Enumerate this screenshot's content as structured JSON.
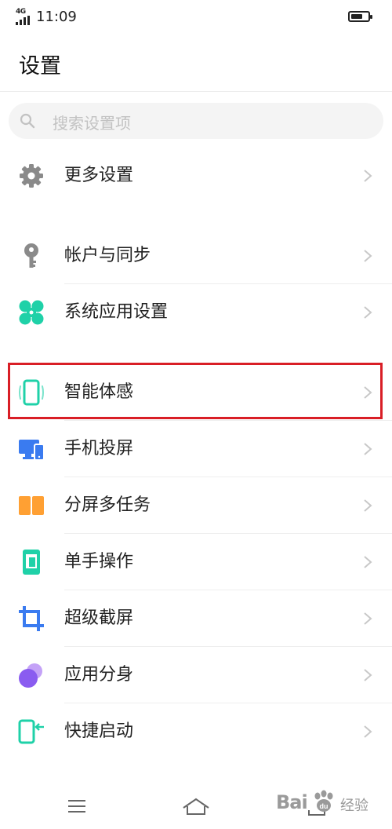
{
  "status_bar": {
    "network": "4G",
    "time": "11:09"
  },
  "header": {
    "title": "设置"
  },
  "search": {
    "placeholder": "搜索设置项"
  },
  "items": [
    {
      "label": "更多设置",
      "icon": "gear-icon"
    },
    {
      "label": "帐户与同步",
      "icon": "key-icon"
    },
    {
      "label": "系统应用设置",
      "icon": "apps-grid-icon"
    },
    {
      "label": "智能体感",
      "icon": "smart-motion-phone-icon"
    },
    {
      "label": "手机投屏",
      "icon": "screen-cast-icon"
    },
    {
      "label": "分屏多任务",
      "icon": "split-screen-icon"
    },
    {
      "label": "单手操作",
      "icon": "one-hand-icon"
    },
    {
      "label": "超级截屏",
      "icon": "crop-icon"
    },
    {
      "label": "应用分身",
      "icon": "app-clone-icon"
    },
    {
      "label": "快捷启动",
      "icon": "quick-launch-icon"
    }
  ],
  "watermark": {
    "brand": "Bai",
    "sub": "经验"
  },
  "colors": {
    "highlight": "#d91e26",
    "teal": "#1fd1a8",
    "blue": "#3a7bf0",
    "orange": "#ffa033",
    "purple": "#8a5cf0",
    "gray_icon": "#8a8a8a"
  }
}
